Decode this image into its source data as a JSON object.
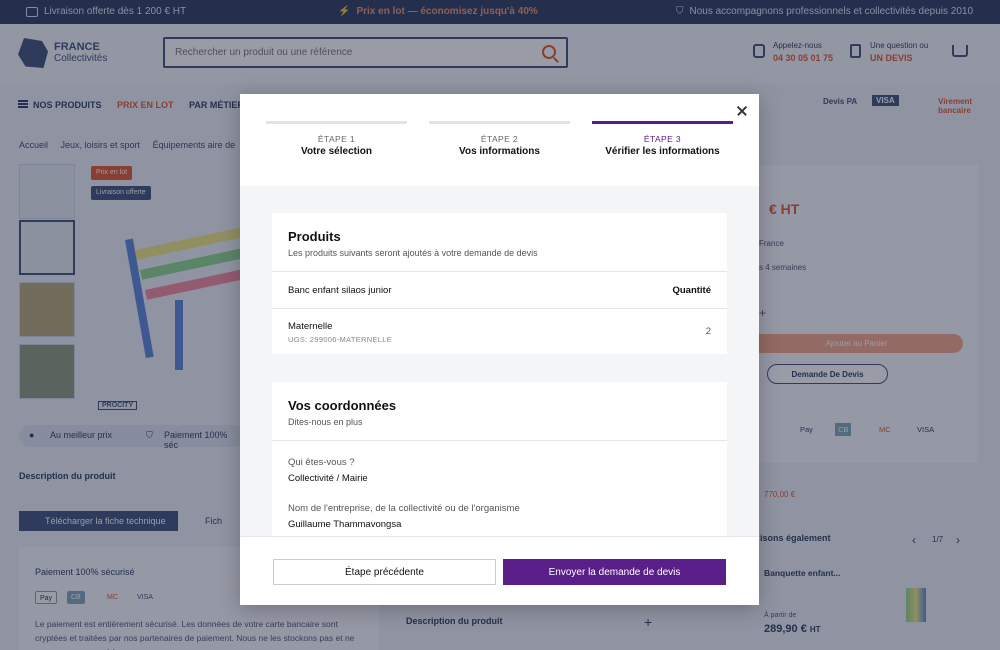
{
  "topbar": {
    "delivery": "Livraison offerte dès 1 200 € HT",
    "promo": "Prix en lot — économisez jusqu'à 40%",
    "support": "Nous accompagnons professionnels et collectivités depuis 2010"
  },
  "header": {
    "logo_line1": "FRANCE",
    "logo_line2": "Collectivités",
    "search_placeholder": "Rechercher un produit ou une référence",
    "phone_label": "Appelez-nous",
    "phone_number": "04 30 05 01 75",
    "question_label": "Une question ou",
    "quote_link": "UN DEVIS"
  },
  "nav": {
    "products": "NOS PRODUITS",
    "lot": "PRIX EN LOT",
    "trade": "PAR MÉTIER"
  },
  "payment_logos": [
    "Devis PA",
    "VISA",
    "Virement bancaire"
  ],
  "breadcrumb": [
    "Accueil",
    "Jeux, loisirs et sport",
    "Équipements aire de"
  ],
  "tags": {
    "lot": "Prix en lot",
    "delivery": "Livraison offerte"
  },
  "brand_badge": "PROCITY",
  "guarantees": {
    "best_price": "Au meilleur prix",
    "secure": "Paiement 100% séc"
  },
  "background": {
    "description_title": "Description du produit",
    "download_button": "Télécharger la fiche technique",
    "download_button2": "Fich",
    "secure_title": "Paiement 100% sécurisé",
    "secure_text": "Le paiement est entièrement sécurisé. Les données de votre carte bancaire sont cryptées et traitées par nos partenaires de paiement. Nous ne les stockons pas et ne pouvons pas y accéder.",
    "pay_methods": [
      "Pay",
      "CB",
      "MC",
      "VISA"
    ],
    "description_title2": "Description du produit"
  },
  "right_panel": {
    "price": "€ HT",
    "line1": "France",
    "line2": "s 4 semaines",
    "add_to_cart": "Ajouter au Panier",
    "quote_button": "Demande De Devis",
    "pay": [
      "Pay",
      "CB",
      "MC",
      "VISA"
    ],
    "old_price": "770,00 €",
    "also_title": "isons également",
    "pager": "1/7",
    "rec_name": "Banquette enfant...",
    "rec_from": "À partir de",
    "rec_price": "289,90 €",
    "rec_price_unit": "HT"
  },
  "modal": {
    "steps": [
      {
        "number": "ÉTAPE 1",
        "label": "Votre sélection"
      },
      {
        "number": "ÉTAPE 2",
        "label": "Vos informations"
      },
      {
        "number": "ÉTAPE 3",
        "label": "Vérifier les informations"
      }
    ],
    "active_step": 3,
    "products_card": {
      "title": "Produits",
      "subtitle": "Les produits suivants seront ajoutés à votre demande de devis",
      "product_name": "Banc enfant silaos junior",
      "qty_header": "Quantité",
      "variant": "Maternelle",
      "sku": "UGS: 299006-MATERNELLE",
      "quantity": "2"
    },
    "contact_card": {
      "title": "Vos coordonnées",
      "subtitle": "Dites-nous en plus",
      "who_label": "Qui êtes-vous ?",
      "who_value": "Collectivité / Mairie",
      "org_label": "Nom de l'entreprise, de la collectivité ou de l'organisme",
      "org_value": "Guillaume Thammavongsa"
    },
    "prev_button": "Étape précédente",
    "send_button": "Envoyer la demande de devis"
  },
  "colors": {
    "accent": "#5a1e88",
    "brand_navy": "#2b3a5c",
    "orange": "#e4552a"
  }
}
